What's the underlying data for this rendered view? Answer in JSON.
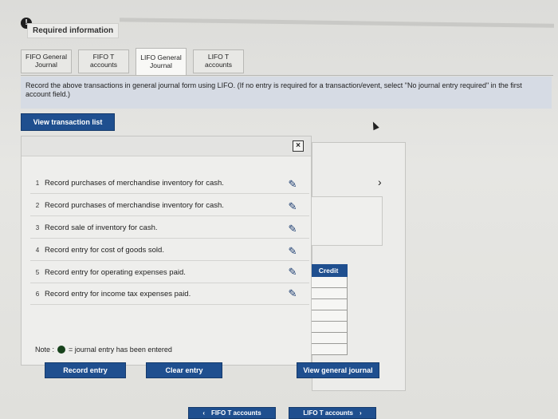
{
  "header": {
    "badge": "!",
    "required_label": "Required information"
  },
  "tabs": [
    {
      "label": "FIFO General Journal",
      "active": false
    },
    {
      "label": "FIFO T accounts",
      "active": false
    },
    {
      "label": "LIFO General Journal",
      "active": true
    },
    {
      "label": "LIFO T accounts",
      "active": false
    }
  ],
  "instruction": "Record the above transactions in general journal form using LIFO. (If no entry is required for a transaction/event, select \"No journal entry required\" in the first account field.)",
  "view_transaction_list": "View transaction list",
  "modal": {
    "close_label": "×",
    "rows": [
      {
        "num": "1",
        "text": "Record purchases of merchandise inventory for cash."
      },
      {
        "num": "2",
        "text": "Record purchases of merchandise inventory for cash."
      },
      {
        "num": "3",
        "text": "Record sale of inventory for cash."
      },
      {
        "num": "4",
        "text": "Record entry for cost of goods sold."
      },
      {
        "num": "5",
        "text": "Record entry for operating expenses paid."
      },
      {
        "num": "6",
        "text": "Record entry for income tax expenses paid."
      }
    ]
  },
  "note": {
    "prefix": "Note :",
    "suffix": "= journal entry has been entered"
  },
  "buttons": {
    "record_entry": "Record entry",
    "clear_entry": "Clear entry",
    "view_general_journal": "View general journal",
    "fifo_t_accounts": "FIFO T accounts",
    "lifo_t_accounts": "LIFO T accounts"
  },
  "credit_header": "Credit",
  "icons": {
    "edit": "pencil-icon",
    "close": "close-icon",
    "next": "chevron-right-icon",
    "prev": "chevron-left-icon",
    "entered": "green-dot-icon"
  },
  "colors": {
    "accent": "#1f4f8f",
    "entered_dot": "#17421c"
  }
}
